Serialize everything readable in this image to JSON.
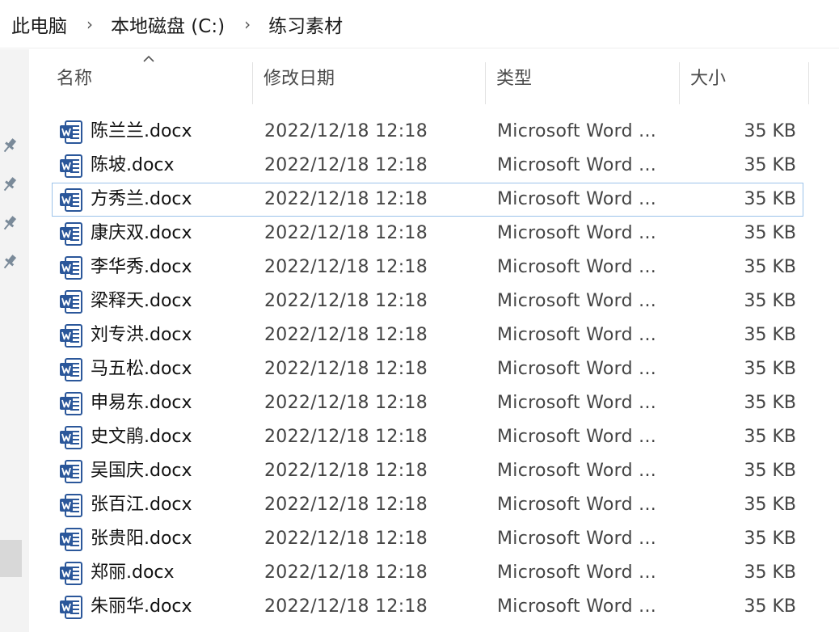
{
  "breadcrumb": {
    "items": [
      "此电脑",
      "本地磁盘 (C:)",
      "练习素材"
    ],
    "separator": "›"
  },
  "columns": {
    "name": "名称",
    "date": "修改日期",
    "type": "类型",
    "size": "大小",
    "sort_indicator": "sort-ascending-caret"
  },
  "files": [
    {
      "name": "陈兰兰.docx",
      "date": "2022/12/18 12:18",
      "type": "Microsoft Word ...",
      "size": "35 KB"
    },
    {
      "name": "陈坡.docx",
      "date": "2022/12/18 12:18",
      "type": "Microsoft Word ...",
      "size": "35 KB"
    },
    {
      "name": "方秀兰.docx",
      "date": "2022/12/18 12:18",
      "type": "Microsoft Word ...",
      "size": "35 KB"
    },
    {
      "name": "康庆双.docx",
      "date": "2022/12/18 12:18",
      "type": "Microsoft Word ...",
      "size": "35 KB"
    },
    {
      "name": "李华秀.docx",
      "date": "2022/12/18 12:18",
      "type": "Microsoft Word ...",
      "size": "35 KB"
    },
    {
      "name": "梁释天.docx",
      "date": "2022/12/18 12:18",
      "type": "Microsoft Word ...",
      "size": "35 KB"
    },
    {
      "name": "刘专洪.docx",
      "date": "2022/12/18 12:18",
      "type": "Microsoft Word ...",
      "size": "35 KB"
    },
    {
      "name": "马五松.docx",
      "date": "2022/12/18 12:18",
      "type": "Microsoft Word ...",
      "size": "35 KB"
    },
    {
      "name": "申易东.docx",
      "date": "2022/12/18 12:18",
      "type": "Microsoft Word ...",
      "size": "35 KB"
    },
    {
      "name": "史文鹃.docx",
      "date": "2022/12/18 12:18",
      "type": "Microsoft Word ...",
      "size": "35 KB"
    },
    {
      "name": "吴国庆.docx",
      "date": "2022/12/18 12:18",
      "type": "Microsoft Word ...",
      "size": "35 KB"
    },
    {
      "name": "张百江.docx",
      "date": "2022/12/18 12:18",
      "type": "Microsoft Word ...",
      "size": "35 KB"
    },
    {
      "name": "张贵阳.docx",
      "date": "2022/12/18 12:18",
      "type": "Microsoft Word ...",
      "size": "35 KB"
    },
    {
      "name": "郑丽.docx",
      "date": "2022/12/18 12:18",
      "type": "Microsoft Word ...",
      "size": "35 KB"
    },
    {
      "name": "朱丽华.docx",
      "date": "2022/12/18 12:18",
      "type": "Microsoft Word ...",
      "size": "35 KB"
    }
  ],
  "focused_index": 2,
  "icons": {
    "file": "word-document-icon",
    "pin": "pin-icon"
  },
  "colors": {
    "word_blue": "#2b579a",
    "focus_border": "#9cc3ea"
  }
}
